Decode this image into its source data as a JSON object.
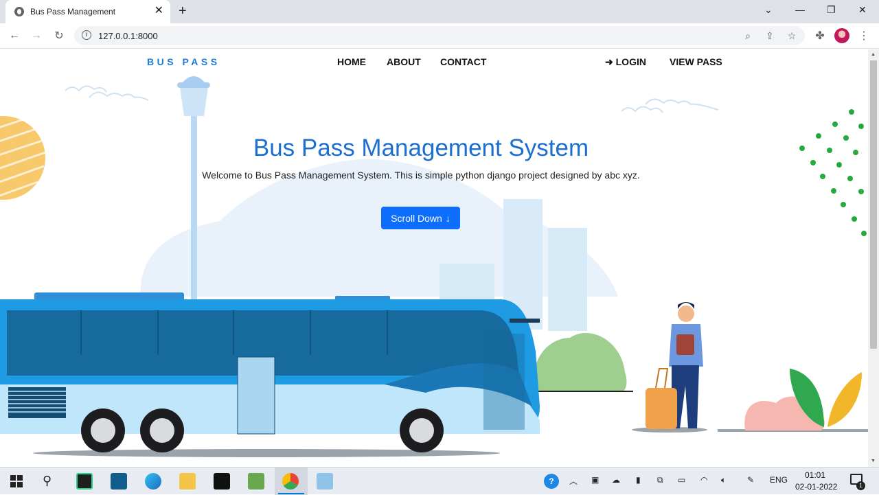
{
  "browser": {
    "tab_title": "Bus Pass Management",
    "url": "127.0.0.1:8000"
  },
  "nav": {
    "brand": "BUS PASS",
    "links": [
      "HOME",
      "ABOUT",
      "CONTACT"
    ],
    "login": "LOGIN",
    "view_pass": "VIEW PASS"
  },
  "hero": {
    "title": "Bus Pass Management System",
    "subtitle": "Welcome to Bus Pass Management System. This is simple python django project designed by abc xyz.",
    "button": "Scroll Down"
  },
  "taskbar": {
    "language": "ENG",
    "time": "01:01",
    "date": "02-01-2022",
    "notifications": "1"
  },
  "colors": {
    "accent": "#0d6efd",
    "title": "#1b6fd0",
    "brand": "#1f7ad9"
  }
}
